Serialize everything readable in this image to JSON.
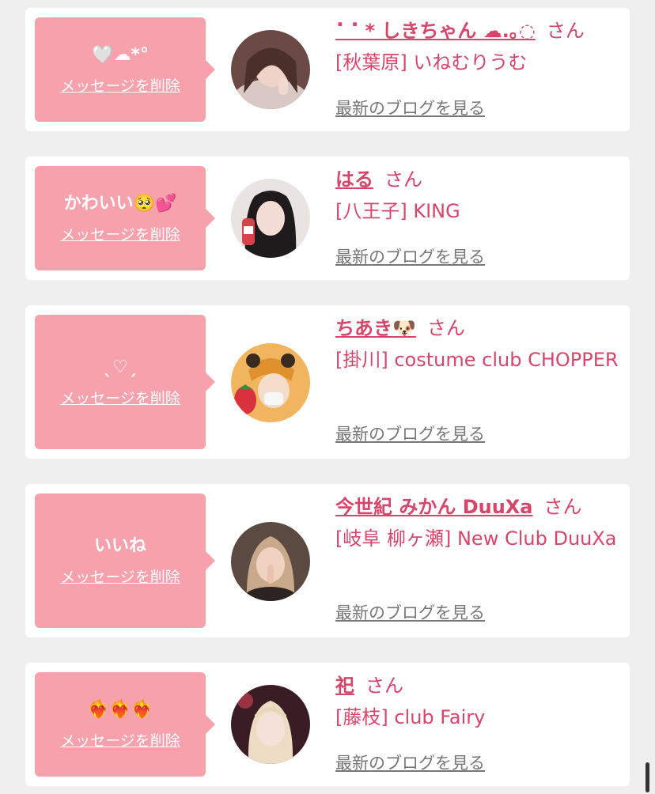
{
  "items": [
    {
      "message": "🤍☁*°",
      "delete_label": "メッセージを削除",
      "name": "⠁⠁* しきちゃん ☁.｡◌",
      "honorific": "さん",
      "shop": "[秋葉原] いねむりうむ",
      "blog_link": "最新のブログを見る"
    },
    {
      "message": "かわいい🥺💕",
      "delete_label": "メッセージを削除",
      "name": "はる",
      "honorific": "さん",
      "shop": "[八王子] KING",
      "blog_link": "最新のブログを見る"
    },
    {
      "message": "ˎ♡ˏ",
      "delete_label": "メッセージを削除",
      "name": "ちあき🐶",
      "honorific": "さん",
      "shop": "[掛川] costume club CHOPPER",
      "blog_link": "最新のブログを見る"
    },
    {
      "message": "いいね",
      "delete_label": "メッセージを削除",
      "name": "今世紀 みかん DuuXa",
      "honorific": "さん",
      "shop": "[岐阜 柳ヶ瀬] New Club DuuXa",
      "blog_link": "最新のブログを見る"
    },
    {
      "message": "❤️‍🔥❤️‍🔥❤️‍🔥",
      "delete_label": "メッセージを削除",
      "name": "祀",
      "honorific": "さん",
      "shop": "[藤枝] club Fairy",
      "blog_link": "最新のブログを見る"
    }
  ],
  "colors": {
    "accent": "#d8456b",
    "bubble": "#f7a1ad",
    "background": "#efefef"
  }
}
